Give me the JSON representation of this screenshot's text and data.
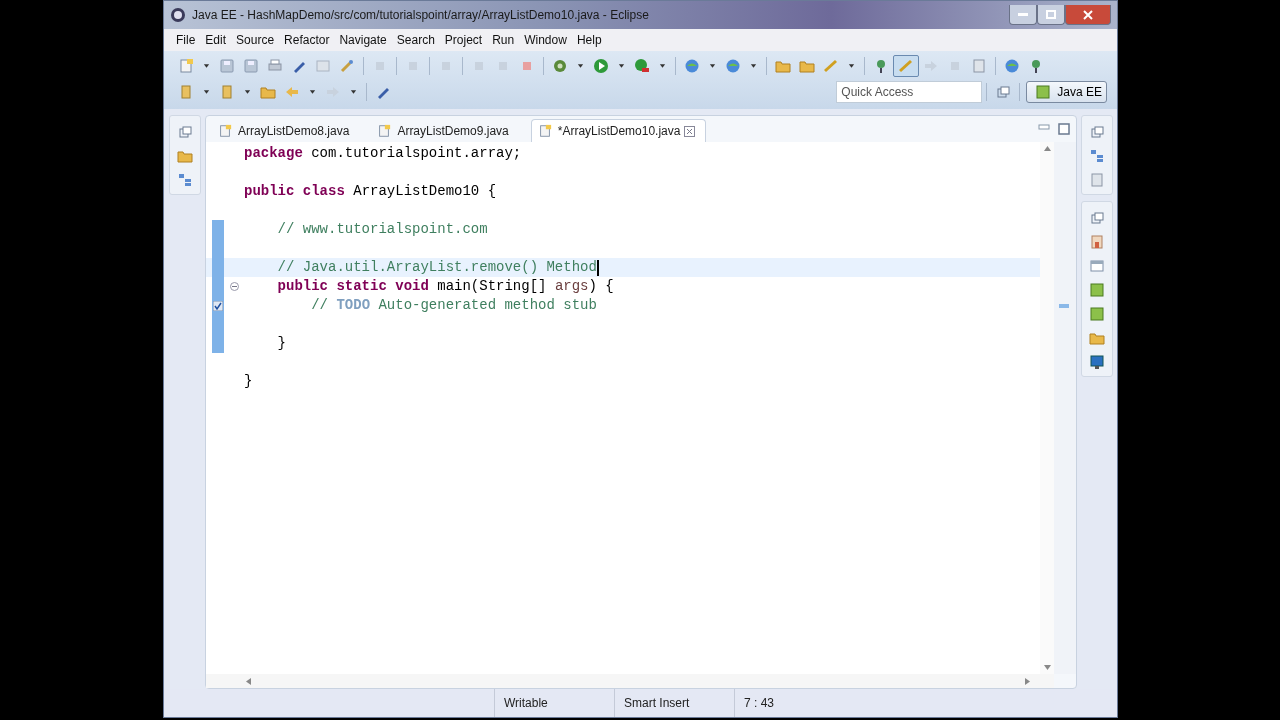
{
  "window": {
    "title": "Java EE - HashMapDemo/src/com/tutorialspoint/array/ArrayListDemo10.java - Eclipse"
  },
  "menu": [
    "File",
    "Edit",
    "Source",
    "Refactor",
    "Navigate",
    "Search",
    "Project",
    "Run",
    "Window",
    "Help"
  ],
  "quick_access": {
    "placeholder": "Quick Access"
  },
  "perspective": {
    "label": "Java EE",
    "selected": true
  },
  "tabs": [
    {
      "label": "ArrayListDemo8.java",
      "selected": false
    },
    {
      "label": "ArrayListDemo9.java",
      "selected": false
    },
    {
      "label": "*ArrayListDemo10.java",
      "selected": true
    }
  ],
  "editor": {
    "lines": [
      {
        "tokens": [
          {
            "kind": "keyword",
            "text": "package"
          },
          {
            "kind": "plain",
            "text": " com.tutorialspoint.array;"
          }
        ],
        "changed": false,
        "current": false
      },
      {
        "changed": false,
        "current": false
      },
      {
        "tokens": [
          {
            "kind": "keyword",
            "text": "public class"
          },
          {
            "kind": "plain",
            "text": " ArrayListDemo10 {"
          }
        ],
        "changed": false,
        "current": false
      },
      {
        "changed": false,
        "current": false
      },
      {
        "tokens": [
          {
            "kind": "comment",
            "text": "    // www.tutorialspoint.com"
          }
        ],
        "changed": true,
        "current": false
      },
      {
        "changed": true,
        "current": false
      },
      {
        "tokens": [
          {
            "kind": "comment",
            "text": "    // Java.util.ArrayList.remove() Method"
          }
        ],
        "changed": true,
        "current": true
      },
      {
        "tokens": [
          {
            "kind": "keyword",
            "text": "    public static void"
          },
          {
            "kind": "plain",
            "text": " main(String[] "
          },
          {
            "kind": "param",
            "text": "args"
          },
          {
            "kind": "plain",
            "text": ") {"
          }
        ],
        "changed": true,
        "current": false,
        "fold_marker": true
      },
      {
        "tokens": [
          {
            "kind": "comment",
            "text": "        // "
          },
          {
            "kind": "todo",
            "text": "TODO"
          },
          {
            "kind": "comment",
            "text": " Auto-generated method stub"
          }
        ],
        "changed": true,
        "current": false,
        "task_marker": true
      },
      {
        "changed": true,
        "current": false
      },
      {
        "tokens": [
          {
            "kind": "plain",
            "text": "    }"
          }
        ],
        "changed": true,
        "current": false
      },
      {
        "changed": false,
        "current": false
      },
      {
        "tokens": [
          {
            "kind": "plain",
            "text": "}"
          }
        ],
        "changed": false,
        "current": false
      }
    ]
  },
  "status_bar": [
    "Writable",
    "Smart Insert",
    "7 : 43"
  ]
}
